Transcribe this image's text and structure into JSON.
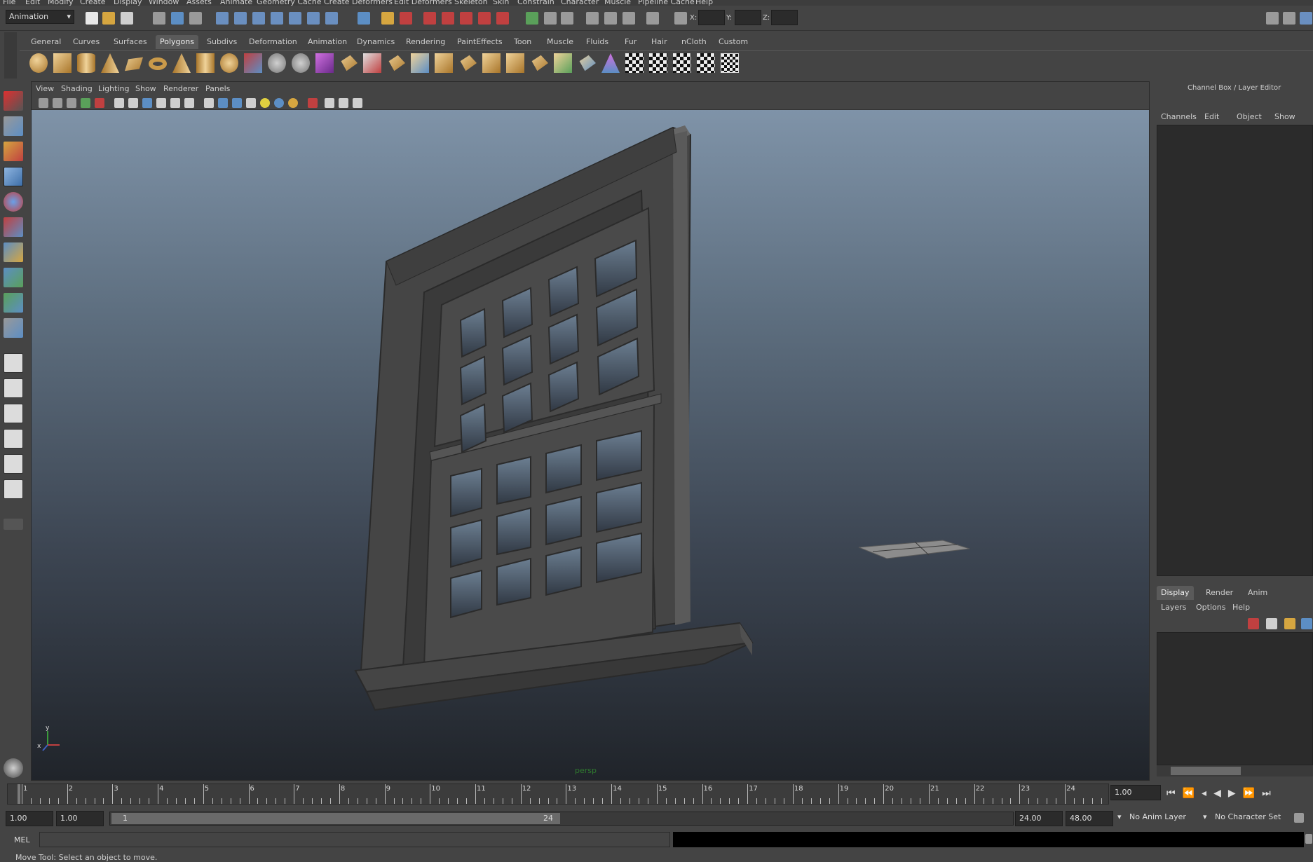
{
  "menubar": {
    "items": [
      "File",
      "Edit",
      "Modify",
      "Create",
      "Display",
      "Window",
      "Assets",
      "Animate",
      "Geometry Cache",
      "Create Deformers",
      "Edit Deformers",
      "Skeleton",
      "Skin",
      "Constrain",
      "Character",
      "Muscle",
      "Pipeline Cache",
      "Help"
    ]
  },
  "statusline": {
    "mode": "Animation",
    "x_label": "X:",
    "y_label": "Y:",
    "z_label": "Z:"
  },
  "shelf": {
    "tabs": [
      "General",
      "Curves",
      "Surfaces",
      "Polygons",
      "Subdivs",
      "Deformation",
      "Animation",
      "Dynamics",
      "Rendering",
      "PaintEffects",
      "Toon",
      "Muscle",
      "Fluids",
      "Fur",
      "Hair",
      "nCloth",
      "Custom"
    ],
    "active_tab": "Polygons"
  },
  "viewport": {
    "menu": [
      "View",
      "Shading",
      "Lighting",
      "Show",
      "Renderer",
      "Panels"
    ],
    "camera_label": "persp",
    "axis_x": "x",
    "axis_y": "y"
  },
  "channel_box": {
    "title": "Channel Box / Layer Editor",
    "menu": [
      "Channels",
      "Edit",
      "Object",
      "Show"
    ]
  },
  "layer_editor": {
    "tabs": [
      "Display",
      "Render",
      "Anim"
    ],
    "active_tab": "Display",
    "menu": [
      "Layers",
      "Options",
      "Help"
    ]
  },
  "time_slider": {
    "ticks": [
      "1",
      "2",
      "3",
      "4",
      "5",
      "6",
      "7",
      "8",
      "9",
      "10",
      "11",
      "12",
      "13",
      "14",
      "15",
      "16",
      "17",
      "18",
      "19",
      "20",
      "21",
      "22",
      "23",
      "24"
    ],
    "current_time": "1.00"
  },
  "range_slider": {
    "anim_start": "1.00",
    "range_start": "1.00",
    "bar_start": "1",
    "bar_end": "24",
    "range_end": "24.00",
    "anim_end": "48.00",
    "anim_layer": "No Anim Layer",
    "character_set": "No Character Set"
  },
  "command_line": {
    "language": "MEL"
  },
  "help_line": {
    "text": "Move Tool: Select an object to move."
  }
}
